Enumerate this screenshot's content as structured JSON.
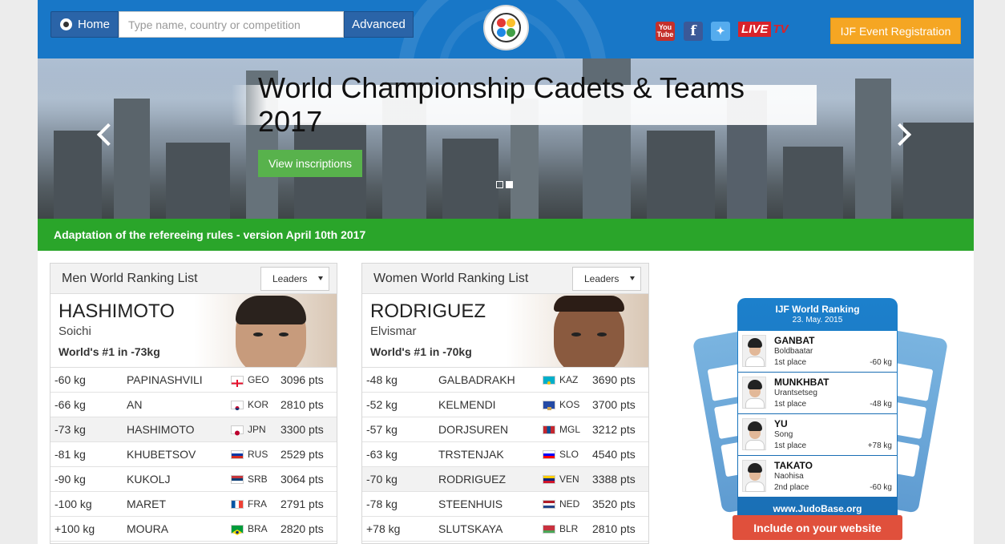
{
  "header": {
    "home_label": "Home",
    "search_placeholder": "Type name, country or competition",
    "advanced_label": "Advanced",
    "registration_label": "IJF Event Registration",
    "live_text": "LIVE",
    "tv_text": "TV",
    "social": [
      "youtube-icon",
      "facebook-icon",
      "twitter-icon"
    ]
  },
  "banner": {
    "title": "World Championship Cadets & Teams 2017",
    "button_label": "View inscriptions"
  },
  "news": {
    "text": "Adaptation of the refereeing rules - version April 10th 2017"
  },
  "men": {
    "heading": "Men World Ranking List",
    "select_value": "Leaders",
    "leader_last": "HASHIMOTO",
    "leader_first": "Soichi",
    "leader_rank": "World's #1 in -73kg",
    "rows": [
      {
        "weight": "-60 kg",
        "name": "PAPINASHVILI",
        "country": "GEO",
        "points": "3096 pts"
      },
      {
        "weight": "-66 kg",
        "name": "AN",
        "country": "KOR",
        "points": "2810 pts"
      },
      {
        "weight": "-73 kg",
        "name": "HASHIMOTO",
        "country": "JPN",
        "points": "3300 pts"
      },
      {
        "weight": "-81 kg",
        "name": "KHUBETSOV",
        "country": "RUS",
        "points": "2529 pts"
      },
      {
        "weight": "-90 kg",
        "name": "KUKOLJ",
        "country": "SRB",
        "points": "3064 pts"
      },
      {
        "weight": "-100 kg",
        "name": "MARET",
        "country": "FRA",
        "points": "2791 pts"
      },
      {
        "weight": "+100 kg",
        "name": "MOURA",
        "country": "BRA",
        "points": "2820 pts"
      }
    ]
  },
  "women": {
    "heading": "Women World Ranking List",
    "select_value": "Leaders",
    "leader_last": "RODRIGUEZ",
    "leader_first": "Elvismar",
    "leader_rank": "World's #1 in -70kg",
    "rows": [
      {
        "weight": "-48 kg",
        "name": "GALBADRAKH",
        "country": "KAZ",
        "points": "3690 pts"
      },
      {
        "weight": "-52 kg",
        "name": "KELMENDI",
        "country": "KOS",
        "points": "3700 pts"
      },
      {
        "weight": "-57 kg",
        "name": "DORJSUREN",
        "country": "MGL",
        "points": "3212 pts"
      },
      {
        "weight": "-63 kg",
        "name": "TRSTENJAK",
        "country": "SLO",
        "points": "4540 pts"
      },
      {
        "weight": "-70 kg",
        "name": "RODRIGUEZ",
        "country": "VEN",
        "points": "3388 pts"
      },
      {
        "weight": "-78 kg",
        "name": "STEENHUIS",
        "country": "NED",
        "points": "3520 pts"
      },
      {
        "weight": "+78 kg",
        "name": "SLUTSKAYA",
        "country": "BLR",
        "points": "2810 pts"
      }
    ]
  },
  "widget": {
    "title": "IJF World Ranking",
    "date": "23. May. 2015",
    "items": [
      {
        "last": "GANBAT",
        "first": "Boldbaatar",
        "place": "1st place",
        "weight": "-60 kg"
      },
      {
        "last": "MUNKHBAT",
        "first": "Urantsetseg",
        "place": "1st place",
        "weight": "-48 kg"
      },
      {
        "last": "YU",
        "first": "Song",
        "place": "1st place",
        "weight": "+78 kg"
      },
      {
        "last": "TAKATO",
        "first": "Naohisa",
        "place": "2nd place",
        "weight": "-60 kg"
      }
    ],
    "url": "www.JudoBase.org",
    "include_label": "Include on your website"
  },
  "colors": {
    "header_blue": "#1877c7",
    "accent_orange": "#f5a623",
    "news_green": "#2aa52a",
    "button_green": "#58b24c",
    "include_red": "#e0503c"
  }
}
